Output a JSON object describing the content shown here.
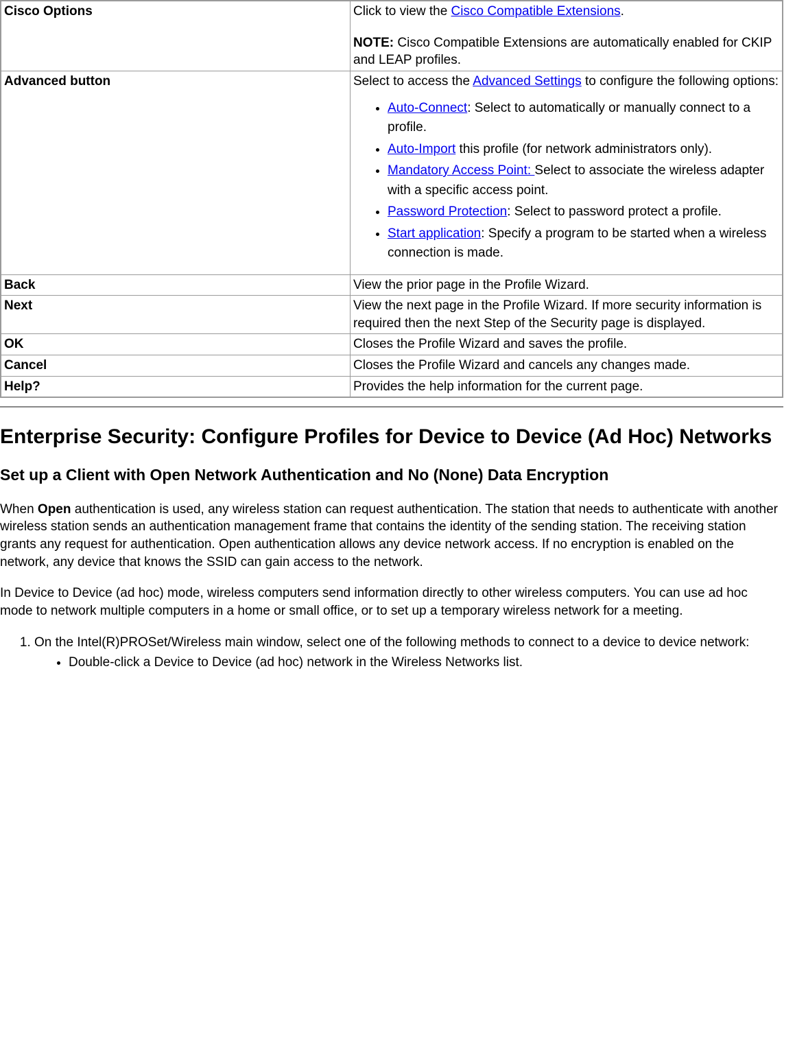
{
  "table": {
    "rows": [
      {
        "label": "Cisco Options",
        "desc_pre": "Click to view the ",
        "link": "Cisco Compatible Extensions",
        "desc_post": ".",
        "note_label": "NOTE:",
        "note_text": " Cisco Compatible Extensions are automatically enabled for CKIP and LEAP profiles."
      },
      {
        "label": "Advanced button",
        "desc_pre": "Select to access the ",
        "link": "Advanced Settings",
        "desc_post": " to configure the following options:",
        "bullets": [
          {
            "link": "Auto-Connect",
            "after": ": Select to automatically or manually connect to a profile."
          },
          {
            "link": "Auto-Import",
            "after": " this profile (for network administrators only)."
          },
          {
            "link": "Mandatory Access Point: ",
            "after": "Select to associate the wireless adapter with a specific access point."
          },
          {
            "link": "Password Protection",
            "after": ": Select to password protect a profile."
          },
          {
            "link": "Start application",
            "after": ": Specify a program to be started when a wireless connection is made."
          }
        ]
      },
      {
        "label": "Back",
        "desc": "View the prior page in the Profile Wizard."
      },
      {
        "label": "Next",
        "desc": "View the next page in the Profile Wizard. If more security information is required then the next Step of the Security page is displayed."
      },
      {
        "label": "OK",
        "desc": "Closes the Profile Wizard and saves the profile."
      },
      {
        "label": "Cancel",
        "desc": "Closes the Profile Wizard and cancels any changes made."
      },
      {
        "label": "Help?",
        "desc": "Provides the help information for the current page."
      }
    ]
  },
  "headings": {
    "h2": "Enterprise Security: Configure Profiles for Device to Device (Ad Hoc) Networks",
    "h3": "Set up a Client with Open Network Authentication and No (None) Data Encryption"
  },
  "paragraphs": {
    "p1_pre": "When ",
    "p1_bold": "Open",
    "p1_post": " authentication is used, any wireless station can request authentication. The station that needs to authenticate with another wireless station sends an authentication management frame that contains the identity of the sending station. The receiving station grants any request for authentication. Open authentication allows any device network access. If no encryption is enabled on the network, any device that knows the SSID can gain access to the network.",
    "p2": "In Device to Device (ad hoc) mode, wireless computers send information directly to other wireless computers. You can use ad hoc mode to network multiple computers in a home or small office, or to set up a temporary wireless network for a meeting."
  },
  "steps": {
    "item1": "On the Intel(R)PROSet/Wireless main window, select one of the following methods to connect to a device to device network:",
    "sub1": "Double-click a Device to Device (ad hoc) network in the Wireless Networks list."
  }
}
